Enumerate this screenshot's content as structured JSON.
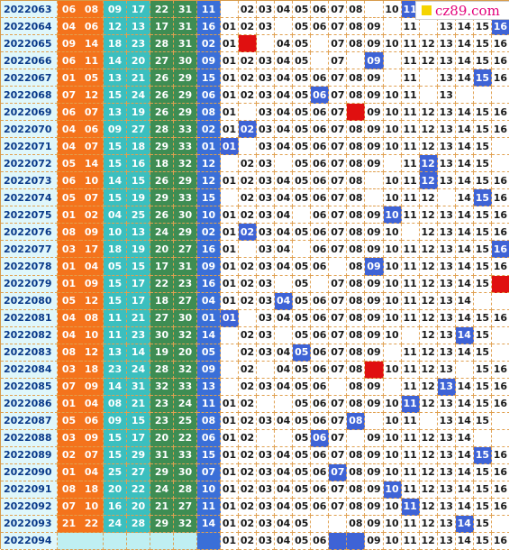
{
  "logo": {
    "text": "cz89.com"
  },
  "colors": {
    "red_zone": "#f4731c",
    "red_zone_alt": "#ee6a10",
    "green_zone": "#3e8d53",
    "teal_zone": "#3bbfbf",
    "blue_col": "#3a6fd8",
    "highlight": "#3e63d6",
    "miss_mark": "#e01010"
  },
  "rows": [
    {
      "issue": "2022063",
      "reds": [
        "06",
        "08",
        "09",
        "17",
        "22",
        "31"
      ],
      "blue": "11",
      "c": [
        "",
        "02",
        "03",
        "04",
        "05",
        "06",
        "07",
        "08",
        "",
        "10",
        "11",
        "",
        "",
        "",
        ""
      ],
      "b": [
        "cz",
        ""
      ]
    },
    {
      "issue": "2022064",
      "reds": [
        "04",
        "06",
        "12",
        "13",
        "17",
        "31"
      ],
      "blue": "16",
      "c": [
        "01",
        "02",
        "03",
        "",
        "05",
        "06",
        "07",
        "08",
        "09",
        "",
        "11",
        "",
        "13",
        "14",
        "15",
        "16"
      ]
    },
    {
      "issue": "2022065",
      "reds": [
        "09",
        "14",
        "18",
        "23",
        "28",
        "31"
      ],
      "blue": "02",
      "c": [
        "01",
        "",
        "",
        "04",
        "05",
        "",
        "07",
        "08",
        "09",
        "10",
        "11",
        "12",
        "13",
        "14",
        "15",
        "16"
      ]
    },
    {
      "issue": "2022066",
      "reds": [
        "06",
        "11",
        "14",
        "20",
        "27",
        "30"
      ],
      "blue": "09",
      "c": [
        "01",
        "02",
        "03",
        "04",
        "05",
        "",
        "07",
        "",
        "09",
        "",
        "11",
        "12",
        "13",
        "14",
        "15",
        "16"
      ]
    },
    {
      "issue": "2022067",
      "reds": [
        "01",
        "05",
        "13",
        "21",
        "26",
        "29"
      ],
      "blue": "15",
      "c": [
        "01",
        "02",
        "03",
        "04",
        "05",
        "06",
        "07",
        "08",
        "09",
        "",
        "11",
        "",
        "13",
        "14",
        "15",
        "16"
      ]
    },
    {
      "issue": "2022068",
      "reds": [
        "07",
        "12",
        "15",
        "24",
        "26",
        "29"
      ],
      "blue": "06",
      "c": [
        "01",
        "02",
        "03",
        "04",
        "05",
        "06",
        "07",
        "08",
        "09",
        "10",
        "11",
        "",
        "13",
        "",
        "",
        ""
      ]
    },
    {
      "issue": "2022069",
      "reds": [
        "06",
        "07",
        "13",
        "19",
        "26",
        "29"
      ],
      "blue": "08",
      "c": [
        "01",
        "",
        "03",
        "04",
        "05",
        "06",
        "07",
        "",
        "09",
        "10",
        "11",
        "12",
        "13",
        "14",
        "15",
        "16"
      ]
    },
    {
      "issue": "2022070",
      "reds": [
        "04",
        "06",
        "09",
        "27",
        "28",
        "33"
      ],
      "blue": "02",
      "c": [
        "01",
        "02",
        "03",
        "04",
        "05",
        "06",
        "07",
        "08",
        "09",
        "10",
        "11",
        "12",
        "13",
        "14",
        "15",
        "16"
      ]
    },
    {
      "issue": "2022071",
      "reds": [
        "04",
        "07",
        "15",
        "18",
        "29",
        "33"
      ],
      "blue": "01",
      "c": [
        "01",
        "",
        "03",
        "04",
        "05",
        "06",
        "07",
        "08",
        "09",
        "10",
        "11",
        "12",
        "13",
        "14",
        "15",
        ""
      ]
    },
    {
      "issue": "2022072",
      "reds": [
        "05",
        "14",
        "15",
        "16",
        "18",
        "32"
      ],
      "blue": "12",
      "c": [
        "",
        "02",
        "03",
        "",
        "05",
        "06",
        "07",
        "08",
        "09",
        "",
        "11",
        "12",
        "13",
        "14",
        "15",
        ""
      ]
    },
    {
      "issue": "2022073",
      "reds": [
        "06",
        "10",
        "14",
        "15",
        "26",
        "29"
      ],
      "blue": "12",
      "c": [
        "01",
        "02",
        "03",
        "04",
        "05",
        "06",
        "07",
        "08",
        "",
        "10",
        "11",
        "12",
        "13",
        "14",
        "15",
        "16"
      ]
    },
    {
      "issue": "2022074",
      "reds": [
        "05",
        "07",
        "15",
        "19",
        "29",
        "33"
      ],
      "blue": "15",
      "c": [
        "",
        "02",
        "03",
        "04",
        "05",
        "06",
        "07",
        "08",
        "",
        "10",
        "11",
        "12",
        "",
        "14",
        "15",
        "16"
      ]
    },
    {
      "issue": "2022075",
      "reds": [
        "01",
        "02",
        "04",
        "25",
        "26",
        "30"
      ],
      "blue": "10",
      "c": [
        "01",
        "02",
        "03",
        "04",
        "",
        "06",
        "07",
        "08",
        "09",
        "10",
        "11",
        "12",
        "13",
        "14",
        "15",
        "16"
      ]
    },
    {
      "issue": "2022076",
      "reds": [
        "08",
        "09",
        "10",
        "13",
        "24",
        "29"
      ],
      "blue": "02",
      "c": [
        "01",
        "02",
        "03",
        "04",
        "05",
        "06",
        "07",
        "08",
        "09",
        "10",
        "",
        "12",
        "13",
        "14",
        "15",
        "16"
      ]
    },
    {
      "issue": "2022077",
      "reds": [
        "03",
        "17",
        "18",
        "19",
        "20",
        "27"
      ],
      "blue": "16",
      "c": [
        "01",
        "",
        "03",
        "04",
        "",
        "06",
        "07",
        "08",
        "09",
        "10",
        "11",
        "12",
        "13",
        "14",
        "15",
        "16"
      ]
    },
    {
      "issue": "2022078",
      "reds": [
        "01",
        "04",
        "05",
        "15",
        "17",
        "31"
      ],
      "blue": "09",
      "c": [
        "01",
        "02",
        "03",
        "04",
        "05",
        "06",
        "",
        "08",
        "09",
        "10",
        "11",
        "12",
        "13",
        "14",
        "15",
        "16"
      ]
    },
    {
      "issue": "2022079",
      "reds": [
        "01",
        "09",
        "15",
        "17",
        "22",
        "23"
      ],
      "blue": "16",
      "c": [
        "01",
        "02",
        "03",
        "",
        "05",
        "",
        "07",
        "08",
        "09",
        "10",
        "11",
        "12",
        "13",
        "14",
        "15",
        ""
      ]
    },
    {
      "issue": "2022080",
      "reds": [
        "05",
        "12",
        "15",
        "17",
        "18",
        "27"
      ],
      "blue": "04",
      "c": [
        "01",
        "02",
        "03",
        "04",
        "05",
        "06",
        "07",
        "08",
        "09",
        "10",
        "11",
        "12",
        "13",
        "14",
        "",
        ""
      ]
    },
    {
      "issue": "2022081",
      "reds": [
        "04",
        "08",
        "11",
        "21",
        "27",
        "30"
      ],
      "blue": "01",
      "c": [
        "01",
        "",
        "03",
        "04",
        "05",
        "06",
        "07",
        "08",
        "09",
        "10",
        "11",
        "12",
        "13",
        "14",
        "15",
        "16"
      ]
    },
    {
      "issue": "2022082",
      "reds": [
        "04",
        "10",
        "11",
        "23",
        "30",
        "32"
      ],
      "blue": "14",
      "c": [
        "",
        "02",
        "03",
        "",
        "05",
        "06",
        "07",
        "08",
        "09",
        "10",
        "",
        "12",
        "13",
        "14",
        "15",
        ""
      ]
    },
    {
      "issue": "2022083",
      "reds": [
        "08",
        "12",
        "13",
        "14",
        "19",
        "20"
      ],
      "blue": "05",
      "c": [
        "",
        "02",
        "03",
        "04",
        "05",
        "06",
        "07",
        "08",
        "09",
        "",
        "11",
        "12",
        "13",
        "14",
        "15",
        ""
      ]
    },
    {
      "issue": "2022084",
      "reds": [
        "03",
        "18",
        "23",
        "24",
        "28",
        "32"
      ],
      "blue": "09",
      "c": [
        "",
        "02",
        "",
        "04",
        "05",
        "06",
        "07",
        "08",
        "",
        "10",
        "11",
        "12",
        "13",
        "",
        "15",
        "16"
      ]
    },
    {
      "issue": "2022085",
      "reds": [
        "07",
        "09",
        "14",
        "31",
        "32",
        "33"
      ],
      "blue": "13",
      "c": [
        "",
        "02",
        "03",
        "04",
        "05",
        "06",
        "",
        "08",
        "09",
        "",
        "11",
        "12",
        "13",
        "14",
        "15",
        "16"
      ]
    },
    {
      "issue": "2022086",
      "reds": [
        "01",
        "04",
        "08",
        "21",
        "23",
        "24"
      ],
      "blue": "11",
      "c": [
        "01",
        "02",
        "",
        "",
        "05",
        "06",
        "07",
        "08",
        "09",
        "10",
        "11",
        "12",
        "13",
        "14",
        "15",
        "16"
      ]
    },
    {
      "issue": "2022087",
      "reds": [
        "05",
        "06",
        "09",
        "15",
        "23",
        "25"
      ],
      "blue": "08",
      "c": [
        "01",
        "02",
        "03",
        "04",
        "05",
        "06",
        "07",
        "08",
        "",
        "10",
        "11",
        "",
        "13",
        "14",
        "15",
        ""
      ]
    },
    {
      "issue": "2022088",
      "reds": [
        "03",
        "09",
        "15",
        "17",
        "20",
        "22"
      ],
      "blue": "06",
      "c": [
        "01",
        "02",
        "",
        "",
        "05",
        "06",
        "07",
        "",
        "09",
        "10",
        "11",
        "12",
        "13",
        "14",
        "",
        ""
      ]
    },
    {
      "issue": "2022089",
      "reds": [
        "02",
        "07",
        "15",
        "29",
        "31",
        "33"
      ],
      "blue": "15",
      "c": [
        "01",
        "02",
        "03",
        "04",
        "05",
        "06",
        "07",
        "08",
        "09",
        "10",
        "11",
        "12",
        "13",
        "14",
        "15",
        "16"
      ]
    },
    {
      "issue": "2022090",
      "reds": [
        "01",
        "04",
        "25",
        "27",
        "29",
        "30"
      ],
      "blue": "07",
      "c": [
        "01",
        "02",
        "03",
        "04",
        "05",
        "06",
        "07",
        "08",
        "09",
        "10",
        "11",
        "12",
        "13",
        "14",
        "15",
        "16"
      ]
    },
    {
      "issue": "2022091",
      "reds": [
        "08",
        "18",
        "20",
        "22",
        "24",
        "28"
      ],
      "blue": "10",
      "c": [
        "01",
        "02",
        "03",
        "04",
        "05",
        "06",
        "07",
        "08",
        "09",
        "10",
        "11",
        "12",
        "13",
        "14",
        "15",
        "16"
      ]
    },
    {
      "issue": "2022092",
      "reds": [
        "07",
        "10",
        "16",
        "20",
        "21",
        "27"
      ],
      "blue": "11",
      "c": [
        "01",
        "02",
        "03",
        "04",
        "05",
        "06",
        "07",
        "08",
        "09",
        "10",
        "11",
        "12",
        "13",
        "14",
        "15",
        "16"
      ]
    },
    {
      "issue": "2022093",
      "reds": [
        "21",
        "22",
        "24",
        "28",
        "29",
        "32"
      ],
      "blue": "14",
      "c": [
        "01",
        "02",
        "03",
        "04",
        "05",
        "",
        "",
        "08",
        "09",
        "10",
        "11",
        "12",
        "13",
        "14",
        "15",
        ""
      ]
    },
    {
      "issue": "2022094",
      "reds": [
        "",
        "",
        "",
        "",
        "",
        ""
      ],
      "blue": "",
      "c": [
        "01",
        "02",
        "03",
        "04",
        "05",
        "06",
        "",
        "",
        "09",
        "10",
        "11",
        "12",
        "13",
        "14",
        "15",
        "16"
      ]
    }
  ],
  "marks": {
    "2022063": {
      "hl": [
        "11"
      ],
      "hot": []
    },
    "2022064": {
      "hl": [
        "16"
      ],
      "hot": []
    },
    "2022065": {
      "hl": [],
      "hot": [
        "02"
      ]
    },
    "2022066": {
      "hl": [
        "09"
      ],
      "hot": []
    },
    "2022067": {
      "hl": [
        "15"
      ],
      "hot": []
    },
    "2022068": {
      "hl": [
        "06"
      ],
      "hot": []
    },
    "2022069": {
      "hl": [],
      "hot": [
        "08"
      ]
    },
    "2022070": {
      "hl": [
        "02"
      ],
      "hot": []
    },
    "2022071": {
      "hl": [
        "01"
      ],
      "hot": []
    },
    "2022072": {
      "hl": [
        "12"
      ],
      "hot": []
    },
    "2022073": {
      "hl": [
        "12"
      ],
      "hot": []
    },
    "2022074": {
      "hl": [
        "15"
      ],
      "hot": []
    },
    "2022075": {
      "hl": [
        "10"
      ],
      "hot": []
    },
    "2022076": {
      "hl": [
        "02"
      ],
      "hot": []
    },
    "2022077": {
      "hl": [
        "16"
      ],
      "hot": []
    },
    "2022078": {
      "hl": [
        "09"
      ],
      "hot": []
    },
    "2022079": {
      "hl": [],
      "hot": [
        "16"
      ]
    },
    "2022080": {
      "hl": [
        "04"
      ],
      "hot": []
    },
    "2022081": {
      "hl": [
        "01"
      ],
      "hot": []
    },
    "2022082": {
      "hl": [
        "14"
      ],
      "hot": []
    },
    "2022083": {
      "hl": [
        "05"
      ],
      "hot": []
    },
    "2022084": {
      "hl": [],
      "hot": [
        "09"
      ]
    },
    "2022085": {
      "hl": [
        "13"
      ],
      "hot": []
    },
    "2022086": {
      "hl": [
        "11"
      ],
      "hot": []
    },
    "2022087": {
      "hl": [
        "08"
      ],
      "hot": []
    },
    "2022088": {
      "hl": [
        "06"
      ],
      "hot": []
    },
    "2022089": {
      "hl": [
        "15"
      ],
      "hot": []
    },
    "2022090": {
      "hl": [
        "07"
      ],
      "hot": []
    },
    "2022091": {
      "hl": [
        "10"
      ],
      "hot": []
    },
    "2022092": {
      "hl": [
        "11"
      ],
      "hot": []
    },
    "2022093": {
      "hl": [
        "14"
      ],
      "hot": []
    },
    "2022094": {
      "hl": [
        "07",
        "08"
      ],
      "hot": []
    }
  }
}
